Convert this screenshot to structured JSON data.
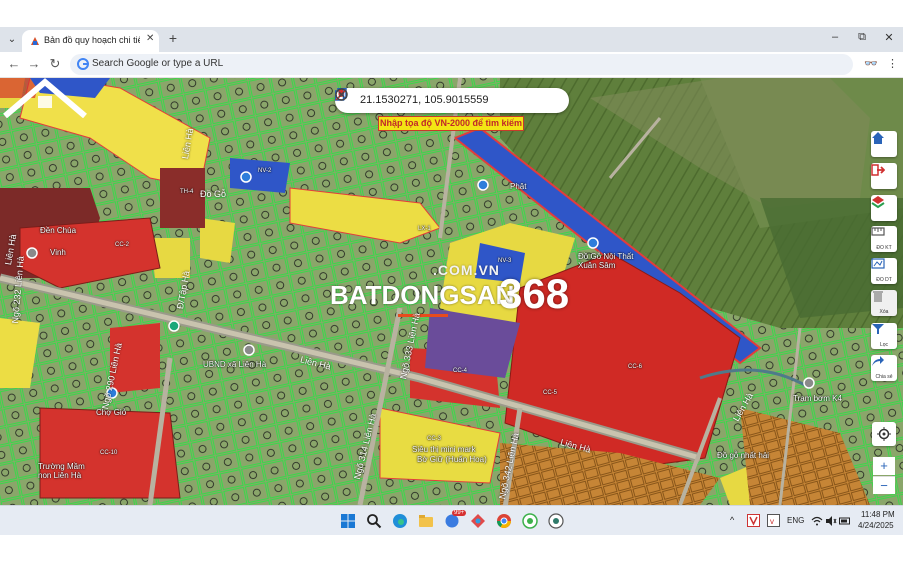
{
  "browser": {
    "tab_title": "Bản đồ quy hoạch chi tiết Đông",
    "tab_close": "✕",
    "new_tab": "+",
    "dropdown": "⌄",
    "window_min": "–",
    "window_restore": "⧉",
    "window_close": "✕",
    "address_placeholder": "Search Google or type a URL"
  },
  "map": {
    "coordinate_value": "21.1530271, 105.9015559",
    "coordinate_hint": "Nhập tọa độ VN-2000 để tìm kiếm",
    "watermark_domain": ".COM.VN",
    "watermark_brand": "BATDONGSAN",
    "watermark_number": "368",
    "place_labels": {
      "den_chua": "Đền Chùa",
      "do_go_noi_that": "Đồ Gỗ Nội Thất Xuân Sâm",
      "tram_bom": "Trạm bơm K4",
      "sieu_thi": "Siêu thị mini mark",
      "sieu_thi_sub": "Bờ Giữ (Huấn Hoa)",
      "do_go_nhat_hai": "Đồ gỗ nhất hải",
      "truong_mam_non": "Trường Mầm non Liên Hà",
      "ubnd": "UBND xã Liên Hà",
      "cho_gio": "Chợ Giỏ",
      "phat": "Phật",
      "vinh": "Vinh"
    },
    "road_labels": {
      "ngo_232": "Ngõ 232 Liên Hà",
      "ngo_290": "Ngõ 290 Liên Hà",
      "ngo_333": "Ngõ 333 Liên Hà",
      "ngo_314": "Ngõ 314 Liên Hà",
      "ngo_342": "Ngõ 342 Liên Hà",
      "lien_ha_1": "Liên Hà",
      "lien_ha_2": "Liên Hà",
      "lien_ha_3": "Liên Hà",
      "lien_ha_4": "Liên Hà",
      "lien_ha_5": "Liên Hà",
      "do_go": "Đồ Gỗ",
      "du_an": "Đ/Tập Hà"
    },
    "parcel_labels": [
      "CC-6",
      "CC-5",
      "CC-10",
      "CC-2",
      "NV-3",
      "NV-2",
      "TH-4",
      "LX-1",
      "CC-3",
      "CC-4"
    ]
  },
  "sidebar": {
    "home_label": "",
    "exit_label": "",
    "layers_label": "",
    "do_kt_label": "ĐO KT",
    "do_dt_label": "ĐO DT",
    "xoa_label": "Xóa",
    "loc_label": "Lọc",
    "chia_se_label": "Chia sẻ"
  },
  "zoom": {
    "in": "+",
    "out": "−"
  },
  "taskbar": {
    "lang": "ENG",
    "time": "11:48 PM",
    "date": "4/24/2025",
    "chevron": "^",
    "badge": "99+"
  }
}
